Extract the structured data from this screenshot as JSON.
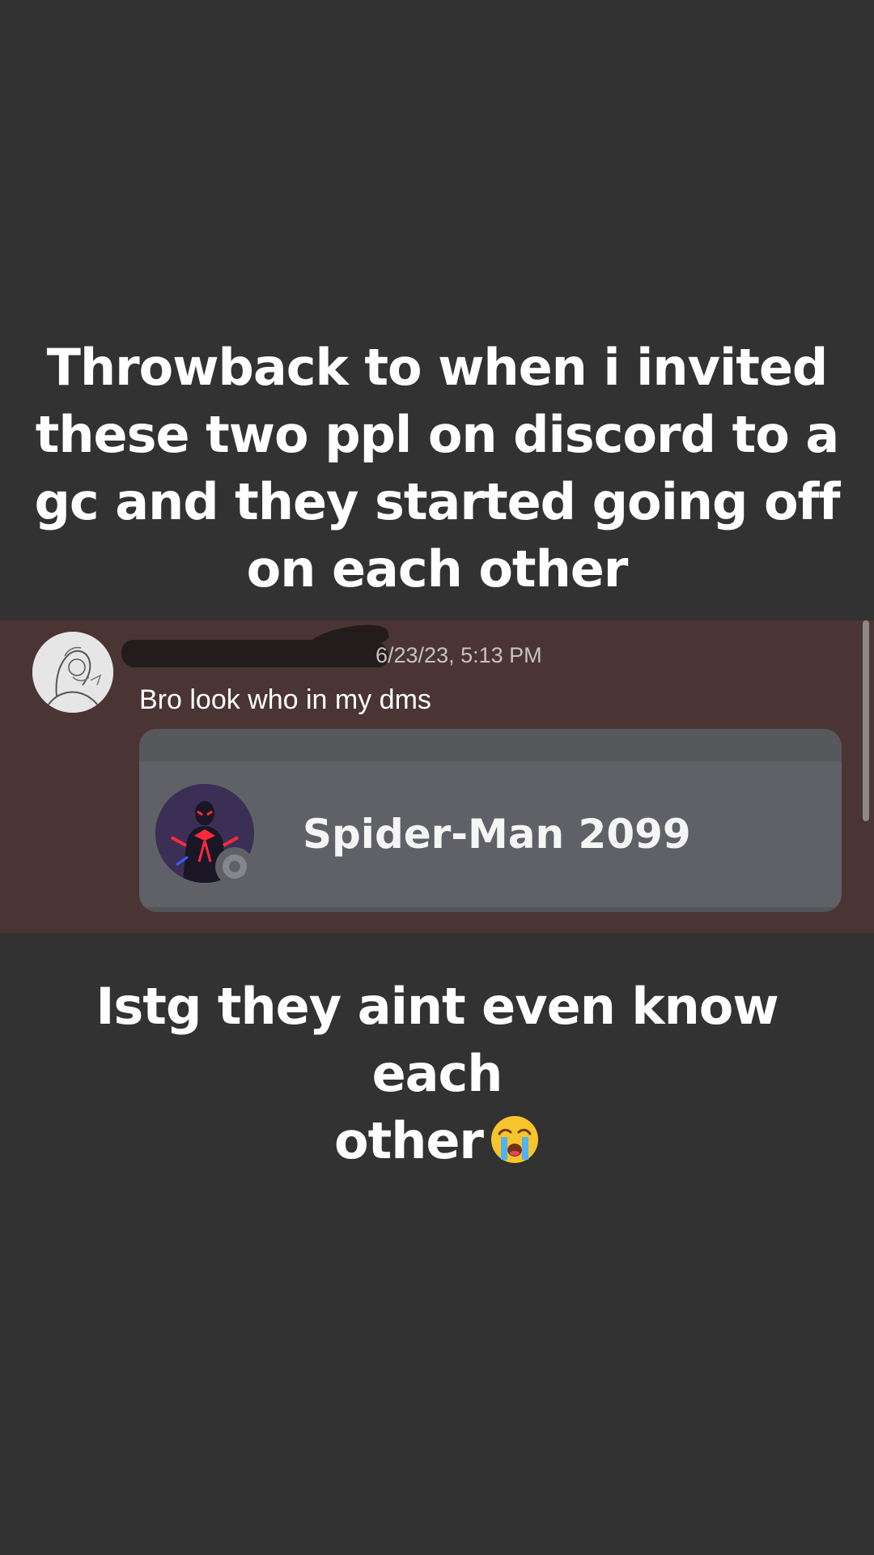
{
  "captions": {
    "top": "Throwback to when i invited\nthese two  ppl on discord to a\ngc and they started going off\non each other",
    "bottom_line1": "Istg they aint even know each",
    "bottom_line2": "other"
  },
  "icons": {
    "crying_emoji": "loudly-crying-face-icon"
  },
  "message": {
    "timestamp": "6/23/23, 5:13 PM",
    "text": "Bro look who in my dms"
  },
  "profile_card": {
    "name": "Spider-Man 2099",
    "status": "offline"
  },
  "colors": {
    "background": "#323232",
    "message_background": "#4a3534",
    "card_background": "#606166"
  }
}
